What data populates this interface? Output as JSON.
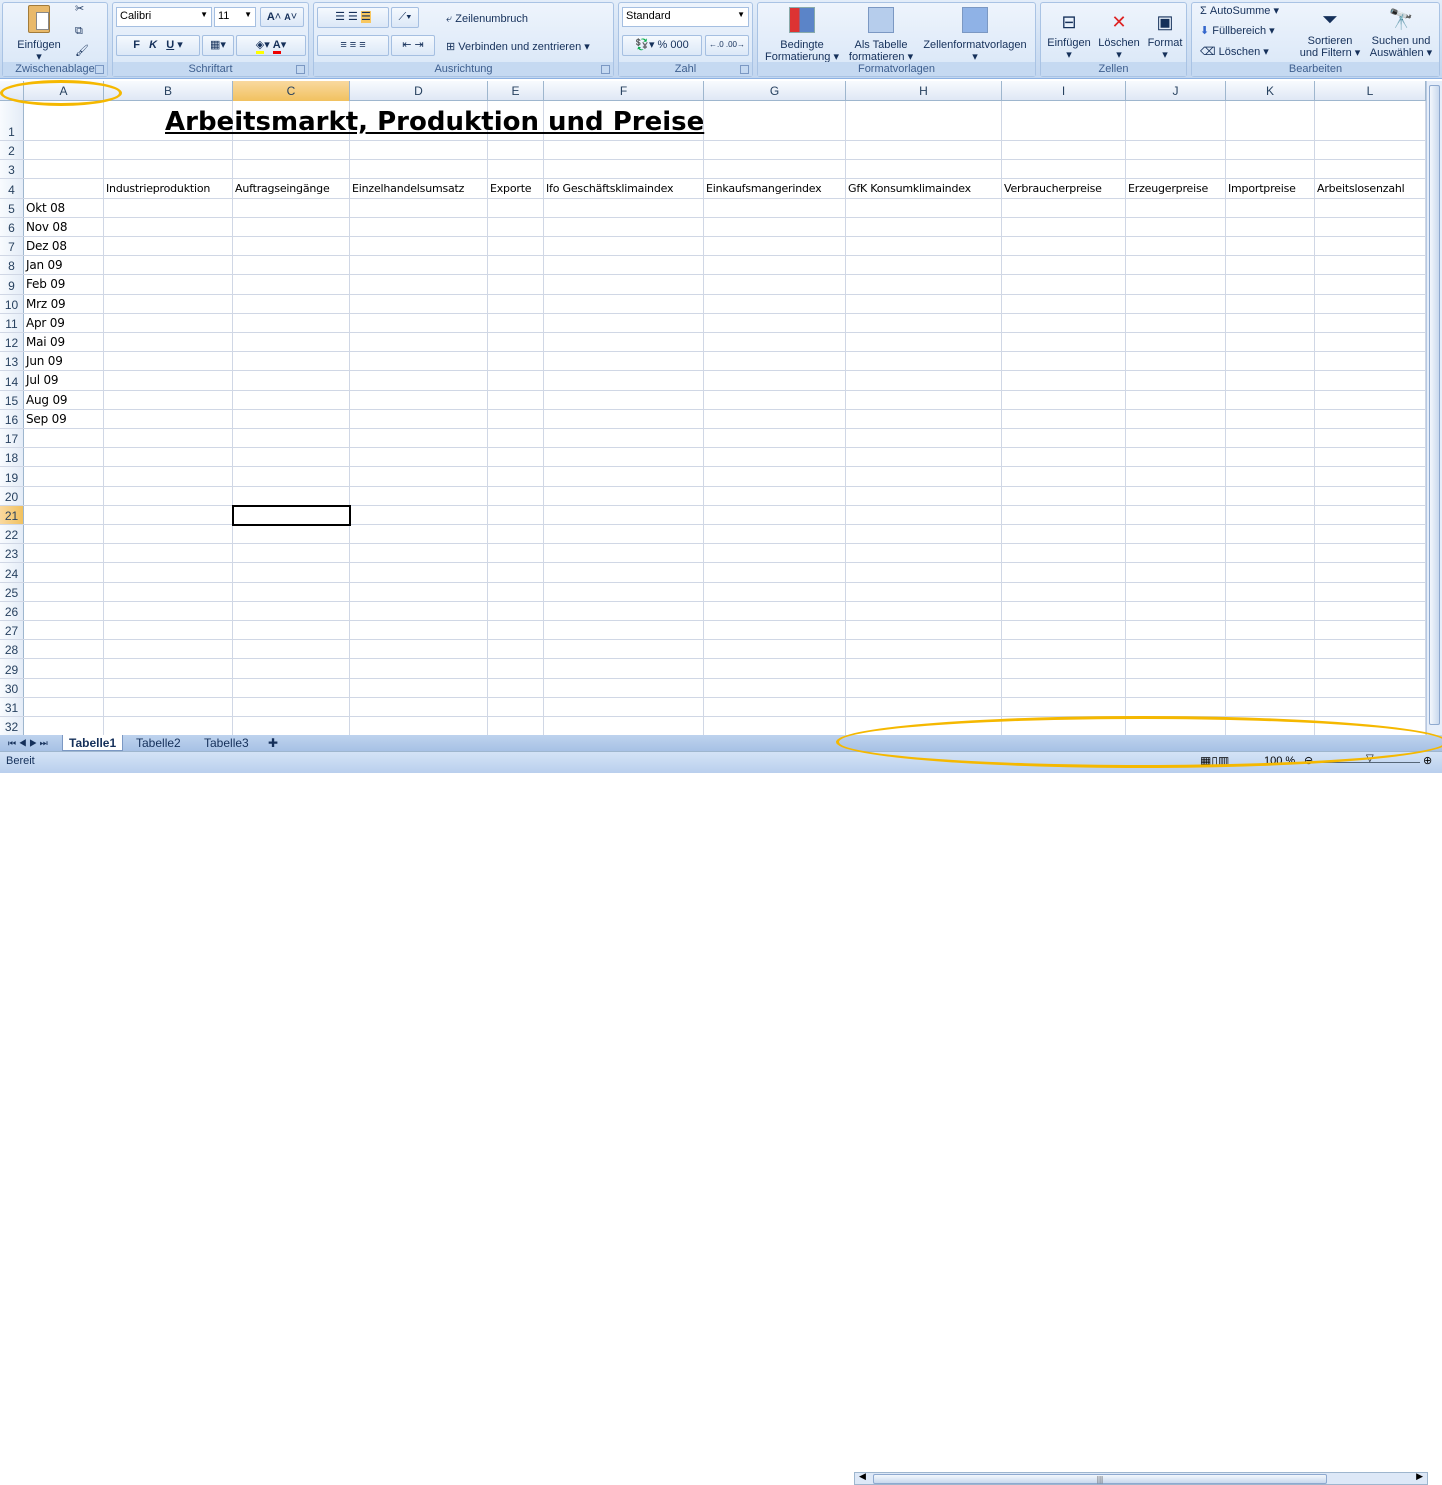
{
  "ribbon": {
    "clipboard": {
      "label": "Zwischenablage",
      "paste": "Einfügen"
    },
    "font": {
      "label": "Schriftart",
      "name": "Calibri",
      "size": "11",
      "bold": "F",
      "italic": "K",
      "underline": "U"
    },
    "alignment": {
      "label": "Ausrichtung",
      "wrap": "Zeilenumbruch",
      "merge": "Verbinden und zentrieren"
    },
    "number": {
      "label": "Zahl",
      "format": "Standard",
      "percent": "%",
      "thousands": "000"
    },
    "styles": {
      "label": "Formatvorlagen",
      "conditional1": "Bedingte",
      "conditional2": "Formatierung",
      "table1": "Als Tabelle",
      "table2": "formatieren",
      "cellstyles": "Zellenformatvorlagen"
    },
    "cells": {
      "label": "Zellen",
      "insert": "Einfügen",
      "delete": "Löschen",
      "format": "Format"
    },
    "editing": {
      "label": "Bearbeiten",
      "autosum": "AutoSumme",
      "fill": "Füllbereich",
      "clear": "Löschen",
      "sort1": "Sortieren",
      "sort2": "und Filtern",
      "find1": "Suchen und",
      "find2": "Auswählen"
    }
  },
  "columns": [
    "A",
    "B",
    "C",
    "D",
    "E",
    "F",
    "G",
    "H",
    "I",
    "J",
    "K",
    "L"
  ],
  "selected_cell": "C21",
  "sheet": {
    "title": "Arbeitsmarkt, Produktion und Preise",
    "headers": [
      "Industrieproduktion",
      "Auftragseingänge",
      "Einzelhandelsumsatz",
      "Exporte",
      "Ifo Geschäftsklimaindex",
      "Einkaufsmangerindex",
      "GfK Konsumklimaindex",
      "Verbraucherpreise",
      "Erzeugerpreise",
      "Importpreise",
      "Arbeitslosenzahl"
    ],
    "months": [
      "Okt 08",
      "Nov 08",
      "Dez 08",
      "Jan 09",
      "Feb 09",
      "Mrz 09",
      "Apr 09",
      "Mai 09",
      "Jun 09",
      "Jul 09",
      "Aug 09",
      "Sep 09"
    ]
  },
  "tabs": [
    "Tabelle1",
    "Tabelle2",
    "Tabelle3"
  ],
  "status": {
    "text": "Bereit",
    "zoom": "100 %"
  }
}
